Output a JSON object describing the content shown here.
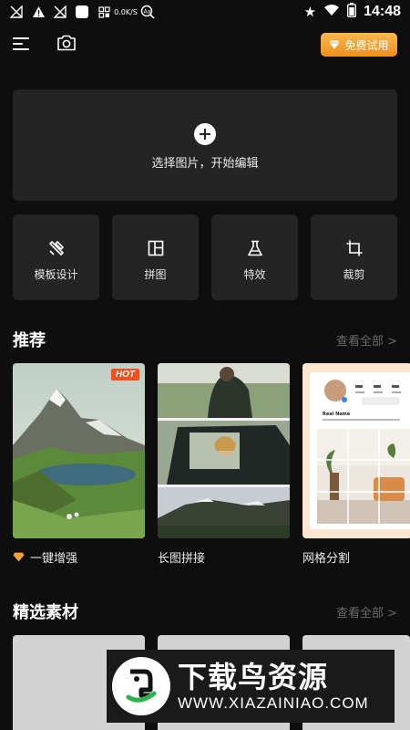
{
  "status_bar": {
    "time": "14:48",
    "left_icons": [
      "signal-off-icon",
      "alert-icon",
      "signal-off-icon",
      "app-square-icon",
      "grid-icon",
      "network-speed-icon",
      "text-scan-icon"
    ],
    "network_speed_text": "0.0K/S",
    "right_icons": [
      "star-icon",
      "wifi-icon",
      "battery-icon"
    ]
  },
  "header": {
    "menu_icon": "menu-icon",
    "camera_icon": "camera-icon",
    "vip_button": {
      "label": "免费试用",
      "icon": "diamond-icon",
      "color": "#f5a236"
    }
  },
  "pick_card": {
    "label": "选择图片，开始编辑",
    "icon": "plus-circle-icon"
  },
  "tools": [
    {
      "label": "模板设计",
      "icon": "template-design-icon"
    },
    {
      "label": "拼图",
      "icon": "collage-icon"
    },
    {
      "label": "特效",
      "icon": "flask-effect-icon"
    },
    {
      "label": "裁剪",
      "icon": "crop-icon"
    }
  ],
  "recommend": {
    "title": "推荐",
    "more": "查看全部 >",
    "items": [
      {
        "label": "一键增强",
        "badge": "HOT",
        "icon": "diamond-icon"
      },
      {
        "label": "长图拼接"
      },
      {
        "label": "网格分割",
        "profile_name": "Real Name"
      }
    ]
  },
  "materials": {
    "title": "精选素材",
    "more": "查看全部 >"
  },
  "watermark": {
    "title": "下载鸟资源",
    "url": "WWW.XIAZAINIAO.COM"
  }
}
